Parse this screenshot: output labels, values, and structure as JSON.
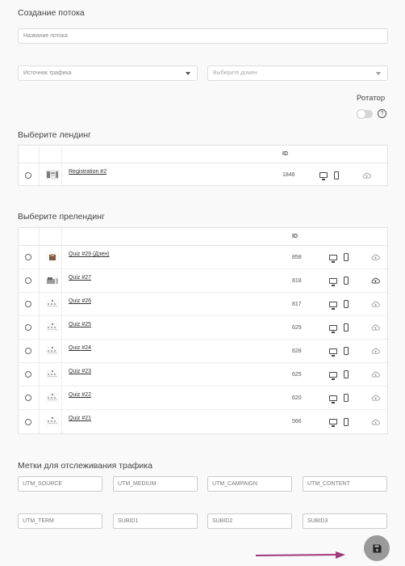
{
  "title": "Создание потока",
  "stream_name": {
    "placeholder": "Название потока",
    "value": ""
  },
  "traffic_source": {
    "placeholder": "Источник трафика"
  },
  "domain": {
    "placeholder": "Выберите домен"
  },
  "rotator": {
    "label": "Ротатор",
    "enabled": false,
    "help_icon": "question-circle-icon"
  },
  "landing": {
    "title": "Выберите лендинг",
    "header_id": "ID",
    "rows": [
      {
        "name": "Registration #2",
        "id": "1846",
        "cloud_icon": "cloud-upload-icon"
      }
    ]
  },
  "prelanding": {
    "title": "Выберите прелендинг",
    "header_id": "ID",
    "rows": [
      {
        "name": "Quiz #29 (Дзен)",
        "id": "858"
      },
      {
        "name": "Quiz #27",
        "id": "818"
      },
      {
        "name": "Quiz #26",
        "id": "817"
      },
      {
        "name": "Quiz #25",
        "id": "629"
      },
      {
        "name": "Quiz #24",
        "id": "628"
      },
      {
        "name": "Quiz #23",
        "id": "625"
      },
      {
        "name": "Quiz #22",
        "id": "620"
      },
      {
        "name": "Quiz #21",
        "id": "566"
      }
    ]
  },
  "tracking": {
    "title": "Метки для отслеживания трафика",
    "fields": [
      "UTM_SOURCE",
      "UTM_MEDIUM",
      "UTM_CAMPAIGN",
      "UTM_CONTENT",
      "UTM_TERM",
      "SUBID1",
      "SUBID2",
      "SUBID3"
    ]
  },
  "save_button": {
    "icon": "save-icon",
    "color": "#9a9a9a"
  },
  "arrow_color": "#a03a7c"
}
